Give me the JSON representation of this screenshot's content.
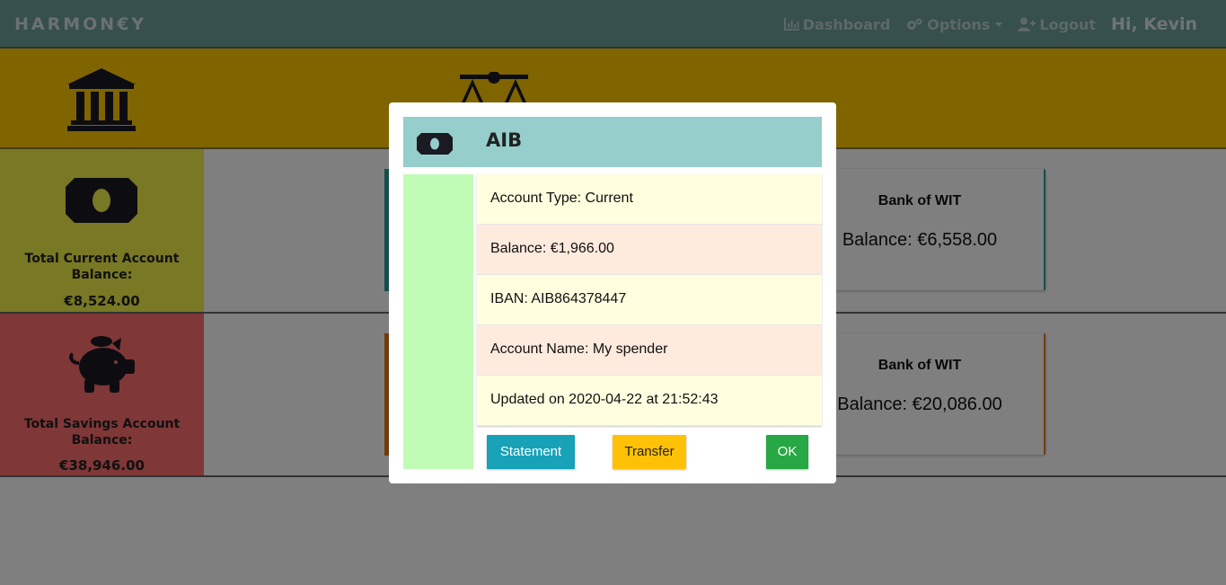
{
  "navbar": {
    "brand": "HARMON€Y",
    "links": {
      "dashboard": "Dashboard",
      "options": "Options",
      "logout": "Logout"
    },
    "greeting": "Hi, Kevin"
  },
  "summary": {
    "current": {
      "label": "Total Current Account Balance:",
      "amount": "€8,524.00"
    },
    "savings": {
      "label": "Total Savings Account Balance:",
      "amount": "€38,946.00"
    }
  },
  "accounts": {
    "current_card": {
      "bank": "Bank of WIT",
      "balance": "Balance: €6,558.00"
    },
    "savings_card": {
      "bank": "Bank of WIT",
      "balance": "Balance: €20,086.00"
    }
  },
  "modal": {
    "title": "AIB",
    "account_type": "Account Type: Current",
    "balance": "Balance: €1,966.00",
    "iban": "IBAN: AIB864378447",
    "account_name": "Account Name: My spender",
    "updated": "Updated on 2020-04-22 at 21:52:43",
    "buttons": {
      "statement": "Statement",
      "transfer": "Transfer",
      "ok": "OK"
    }
  },
  "colors": {
    "navbar": "#6f9f9a",
    "row_banner": "#ffc800",
    "tile_current": "#f0f04a",
    "tile_savings": "#ff6e6e",
    "modal_header": "#95ceca",
    "modal_strip": "#c0fbb6",
    "btn_statement": "#17a2b8",
    "btn_transfer": "#ffc107",
    "btn_ok": "#28a745"
  }
}
